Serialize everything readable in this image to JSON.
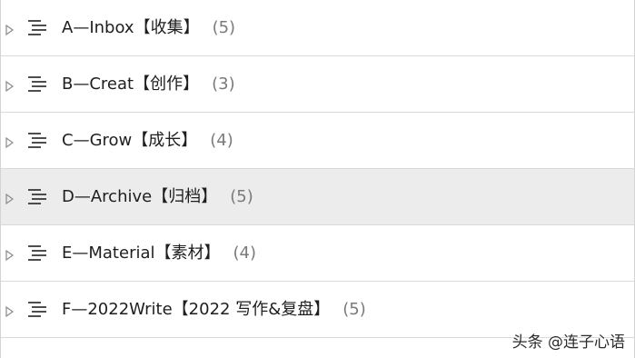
{
  "folders": [
    {
      "name": "A—Inbox【收集】",
      "count": "(5)",
      "selected": false
    },
    {
      "name": "B—Creat【创作】",
      "count": "(3)",
      "selected": false
    },
    {
      "name": "C—Grow【成长】",
      "count": "(4)",
      "selected": false
    },
    {
      "name": "D—Archive【归档】",
      "count": "(5)",
      "selected": true
    },
    {
      "name": "E—Material【素材】",
      "count": "(4)",
      "selected": false
    },
    {
      "name": "F—2022Write【2022 写作&复盘】",
      "count": "(5)",
      "selected": false
    }
  ],
  "icons": {
    "expander": "triangle-right-outline-icon",
    "row_icon": "text-lines-icon"
  },
  "colors": {
    "selected_row_bg": "#ececec",
    "divider": "#d9d9d9",
    "count_text": "#7a7a7a"
  },
  "watermark": "头条 @连子心语"
}
